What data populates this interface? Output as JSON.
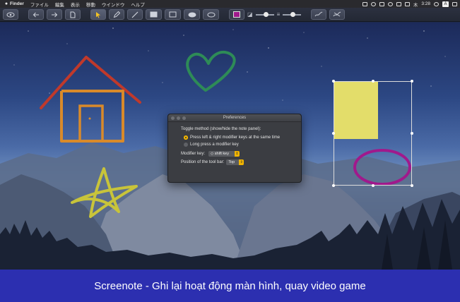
{
  "menubar": {
    "app": "Finder",
    "items": [
      "ファイル",
      "編集",
      "表示",
      "移動",
      "ウインドウ",
      "ヘルプ"
    ],
    "day": "木",
    "time": "3:28",
    "input_indicator": "A"
  },
  "toolbar": {
    "tools": [
      "eye-icon",
      "back-arrow-icon",
      "forward-arrow-icon",
      "document-icon",
      "pointer-icon",
      "pencil-icon",
      "line-icon",
      "filled-rect-icon",
      "rect-icon",
      "filled-ellipse-icon",
      "ellipse-icon"
    ],
    "current_color": "#a0198c"
  },
  "dialog": {
    "title": "Preferences",
    "toggle_label": "Toggle method (show/hide the note panel):",
    "option1": "Press left & right modifier keys at the same time",
    "option2": "Long press a modifier key",
    "modifier_label": "Modifier key:",
    "modifier_value": "◇ shift key",
    "position_label": "Position of the tool bar:",
    "position_value": "Top"
  },
  "caption": {
    "text": "Screenote - Ghi lại hoạt động màn hình, quay video game"
  },
  "colors": {
    "house": "#c0392b",
    "house_body": "#d98a2a",
    "heart": "#2e8b57",
    "star": "#c8c43a",
    "note": "#e3dd6a",
    "ellipse": "#a0198c",
    "caption_bg": "#2c2fb0"
  }
}
